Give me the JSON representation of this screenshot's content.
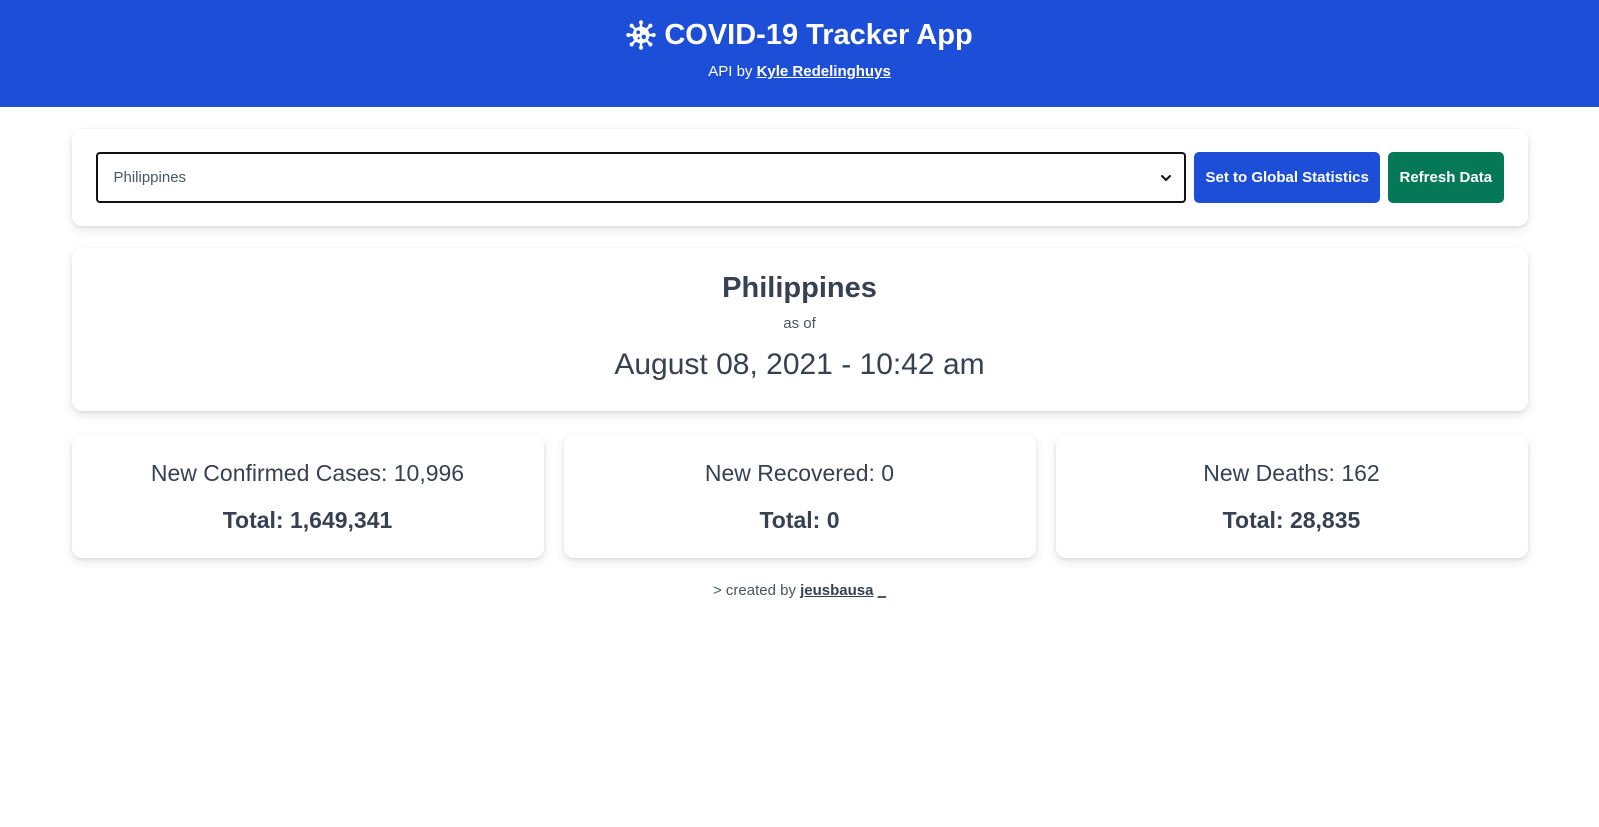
{
  "header": {
    "title": "COVID-19 Tracker App",
    "icon": "virus-icon",
    "api_prefix": "API by",
    "api_author": "Kyle Redelinghuys"
  },
  "controls": {
    "selected_country": "Philippines",
    "global_button": "Set to Global Statistics",
    "refresh_button": "Refresh Data"
  },
  "summary": {
    "country": "Philippines",
    "as_of_label": "as of",
    "datetime": "August 08, 2021 - 10:42 am"
  },
  "stats": [
    {
      "new_label": "New Confirmed Cases: 10,996",
      "total_label": "Total: 1,649,341"
    },
    {
      "new_label": "New Recovered: 0",
      "total_label": "Total: 0"
    },
    {
      "new_label": "New Deaths: 162",
      "total_label": "Total: 28,835"
    }
  ],
  "footer": {
    "prefix": "> created by",
    "author": "jeusbausa",
    "cursor": "_"
  },
  "colors": {
    "header_bg": "#1d4ed8",
    "global_button_bg": "#1d4ed8",
    "refresh_button_bg": "#047857",
    "text": "#374151"
  }
}
